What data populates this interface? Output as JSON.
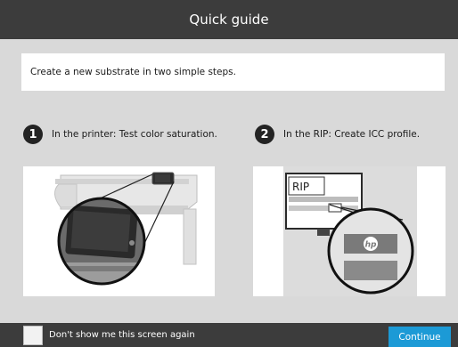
{
  "window": {
    "title": "Quick guide"
  },
  "intro": {
    "text": "Create a new substrate in two simple steps."
  },
  "steps": [
    {
      "number": "1",
      "text": "In the printer: Test color saturation."
    },
    {
      "number": "2",
      "text": "In the RIP: Create ICC profile."
    }
  ],
  "illustration2": {
    "monitor_text": "RIP",
    "logo_text": "hp"
  },
  "footer": {
    "checkbox_label": "Don't show me this screen again",
    "continue_label": "Continue"
  },
  "colors": {
    "titlebar": "#3c3c3c",
    "background": "#d9d9d9",
    "accent": "#1c9ad6"
  }
}
